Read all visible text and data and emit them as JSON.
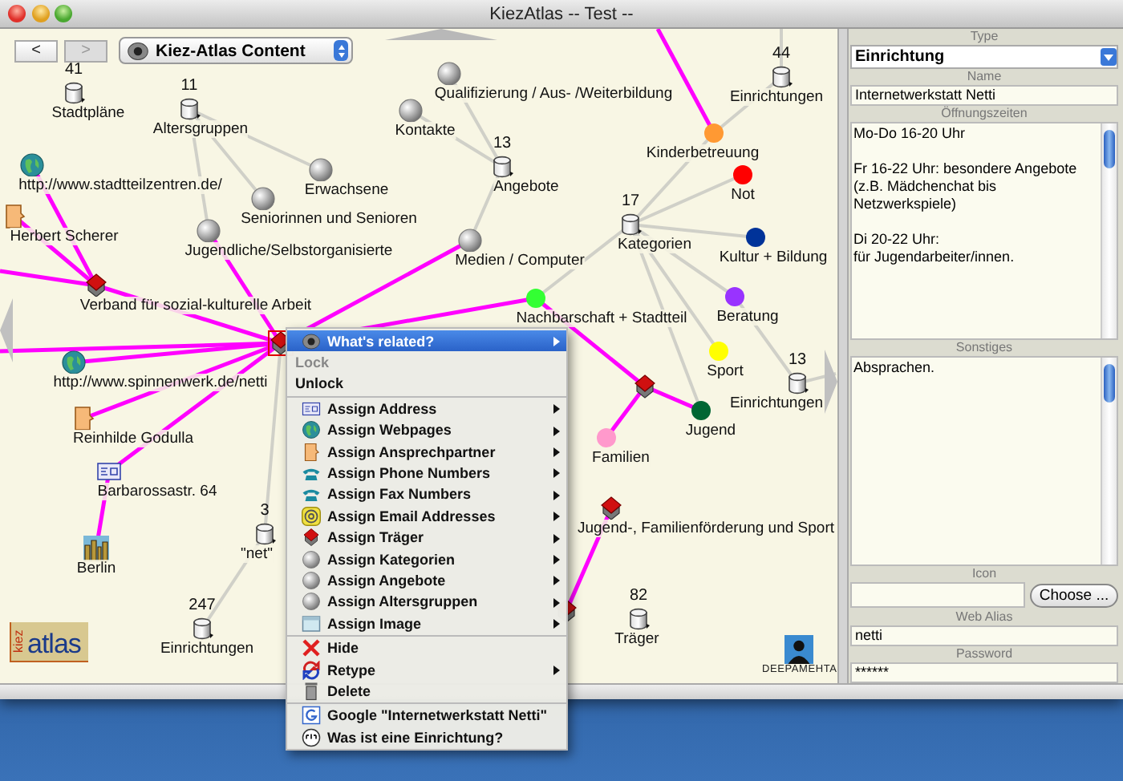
{
  "window": {
    "title": "KiezAtlas -- Test --"
  },
  "toolbar": {
    "back": {
      "label": "<",
      "disabled": false
    },
    "forward": {
      "label": ">",
      "disabled": true
    },
    "view_menu": {
      "value": "Kiez-Atlas Content"
    }
  },
  "graph": {
    "nodes": [
      {
        "kind": "container",
        "count": "41",
        "label": "Stadtpläne",
        "selected": false
      },
      {
        "kind": "container",
        "count": "11",
        "label": "Altersgruppen",
        "selected": false
      },
      {
        "kind": "sphere",
        "label": "Erwachsene",
        "selected": false
      },
      {
        "kind": "sphere",
        "label": "Seniorinnen und Senioren",
        "selected": false
      },
      {
        "kind": "sphere",
        "label": "Jugendliche/Selbstorganisierte",
        "selected": false
      },
      {
        "kind": "web",
        "label": "http://www.stadtteilzentren.de/",
        "selected": false
      },
      {
        "kind": "person",
        "label": "Herbert Scherer",
        "selected": false
      },
      {
        "kind": "institution",
        "label": "Verband für sozial-kulturelle Arbeit",
        "selected": false
      },
      {
        "kind": "sphere",
        "label": "Kontakte",
        "selected": false
      },
      {
        "kind": "sphere",
        "label": "Qualifizierung / Aus- /Weiterbildung",
        "selected": false
      },
      {
        "kind": "container",
        "count": "13",
        "label": "Angebote",
        "selected": false
      },
      {
        "kind": "sphere",
        "label": "Medien / Computer",
        "selected": false
      },
      {
        "kind": "container",
        "count": "44",
        "label": "Einrichtungen",
        "selected": false
      },
      {
        "kind": "category",
        "label": "Kinderbetreuung",
        "color": "#ff9933",
        "selected": false
      },
      {
        "kind": "container",
        "count": "17",
        "label": "Kategorien",
        "selected": false
      },
      {
        "kind": "category",
        "label": "Not",
        "color": "#ff0000",
        "selected": false
      },
      {
        "kind": "category",
        "label": "Kultur + Bildung",
        "color": "#003399",
        "selected": false
      },
      {
        "kind": "category",
        "label": "Nachbarschaft + Stadtteil",
        "color": "#33ff33",
        "selected": false
      },
      {
        "kind": "category",
        "label": "Beratung",
        "color": "#9933ff",
        "selected": false
      },
      {
        "kind": "category",
        "label": "Sport",
        "color": "#ffff00",
        "selected": false
      },
      {
        "kind": "container",
        "count": "13",
        "label": "Einrichtungen",
        "selected": false
      },
      {
        "kind": "category",
        "label": "Jugend",
        "color": "#006633",
        "selected": false
      },
      {
        "kind": "category",
        "label": "Familien",
        "color": "#ff99cc",
        "selected": false
      },
      {
        "kind": "institution",
        "selected": false
      },
      {
        "kind": "institution",
        "label": "Jugend-, Familienförderung und Sport",
        "selected": false
      },
      {
        "kind": "institution",
        "selected": false
      },
      {
        "kind": "container",
        "count": "82",
        "label": "Träger",
        "selected": false
      },
      {
        "kind": "web",
        "label": "http://www.spinnenwerk.de/netti",
        "selected": false
      },
      {
        "kind": "person",
        "label": "Reinhilde Godulla",
        "selected": false
      },
      {
        "kind": "address",
        "label": "Barbarossastr. 64",
        "selected": false
      },
      {
        "kind": "container",
        "count": "3",
        "label": "\"net\"",
        "selected": false
      },
      {
        "kind": "city",
        "label": "Berlin",
        "selected": false
      },
      {
        "kind": "container",
        "count": "247",
        "label": "Einrichtungen",
        "selected": false
      },
      {
        "kind": "institution",
        "selected": true
      }
    ]
  },
  "logo": {
    "top": "kiez",
    "main": "atlas"
  },
  "brand": "DEEPAMEHTA",
  "context_menu": {
    "items": [
      {
        "kind": "item",
        "label": "What's related?",
        "selected": true,
        "disabled": false,
        "submenu": true
      },
      {
        "kind": "item",
        "label": "Lock",
        "selected": false,
        "disabled": true,
        "submenu": false
      },
      {
        "kind": "item",
        "label": "Unlock",
        "selected": false,
        "disabled": false,
        "submenu": false
      },
      {
        "kind": "separator"
      },
      {
        "kind": "item",
        "label": "Assign Address",
        "selected": false,
        "disabled": false,
        "submenu": true
      },
      {
        "kind": "item",
        "label": "Assign Webpages",
        "selected": false,
        "disabled": false,
        "submenu": true
      },
      {
        "kind": "item",
        "label": "Assign Ansprechpartner",
        "selected": false,
        "disabled": false,
        "submenu": true
      },
      {
        "kind": "item",
        "label": "Assign Phone Numbers",
        "selected": false,
        "disabled": false,
        "submenu": true
      },
      {
        "kind": "item",
        "label": "Assign Fax Numbers",
        "selected": false,
        "disabled": false,
        "submenu": true
      },
      {
        "kind": "item",
        "label": "Assign Email Addresses",
        "selected": false,
        "disabled": false,
        "submenu": true
      },
      {
        "kind": "item",
        "label": "Assign Träger",
        "selected": false,
        "disabled": false,
        "submenu": true
      },
      {
        "kind": "item",
        "label": "Assign Kategorien",
        "selected": false,
        "disabled": false,
        "submenu": true
      },
      {
        "kind": "item",
        "label": "Assign Angebote",
        "selected": false,
        "disabled": false,
        "submenu": true
      },
      {
        "kind": "item",
        "label": "Assign Altersgruppen",
        "selected": false,
        "disabled": false,
        "submenu": true
      },
      {
        "kind": "item",
        "label": "Assign Image",
        "selected": false,
        "disabled": false,
        "submenu": true
      },
      {
        "kind": "separator"
      },
      {
        "kind": "item",
        "label": "Hide",
        "selected": false,
        "disabled": false,
        "submenu": false
      },
      {
        "kind": "item",
        "label": "Retype",
        "selected": false,
        "disabled": false,
        "submenu": true
      },
      {
        "kind": "item",
        "label": "Delete",
        "selected": false,
        "disabled": false,
        "submenu": false
      },
      {
        "kind": "separator"
      },
      {
        "kind": "item",
        "label": "Google \"Internetwerkstatt Netti\"",
        "selected": false,
        "disabled": false,
        "submenu": false
      },
      {
        "kind": "item",
        "label": "Was ist eine Einrichtung?",
        "selected": false,
        "disabled": false,
        "submenu": false
      }
    ]
  },
  "properties": {
    "type": {
      "label": "Type",
      "value": "Einrichtung"
    },
    "name": {
      "label": "Name",
      "value": "Internetwerkstatt Netti"
    },
    "opening_hours": {
      "label": "Öffnungszeiten",
      "value": "Mo-Do 16-20 Uhr\n\nFr 16-22 Uhr: besondere Angebote\n(z.B. Mädchenchat bis Netzwerkspiele)\n\nDi 20-22 Uhr:\nfür Jugendarbeiter/innen."
    },
    "other": {
      "label": "Sonstiges",
      "value": "Absprachen."
    },
    "icon": {
      "label": "Icon",
      "button": "Choose ..."
    },
    "web_alias": {
      "label": "Web Alias",
      "value": "netti"
    },
    "password": {
      "label": "Password",
      "value": "******"
    }
  }
}
